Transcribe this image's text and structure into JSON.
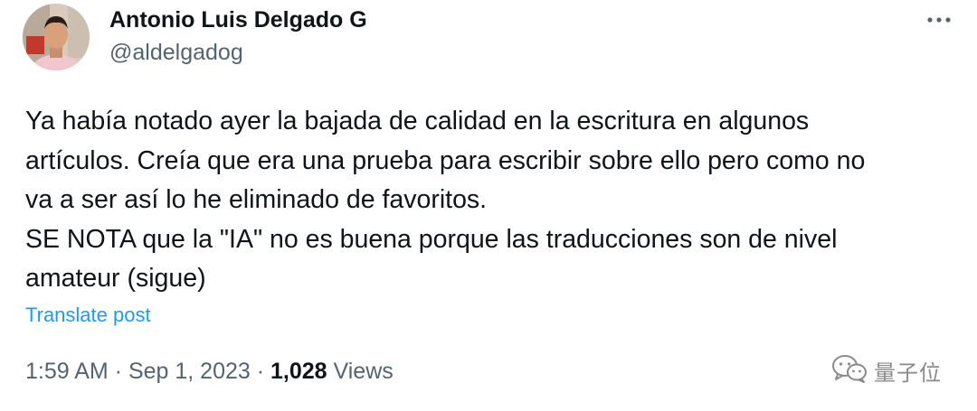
{
  "author": {
    "name": "Antonio Luis Delgado G",
    "handle": "@aldelgadog"
  },
  "tweet": {
    "lines": [
      "Ya había notado ayer la bajada de calidad en la escritura en algunos",
      "artículos. Creía que era una prueba para escribir sobre ello pero como no",
      "va a ser así lo he eliminado de favoritos.",
      "SE NOTA que la \"IA\" no es buena porque las traducciones son de nivel",
      "amateur (sigue)"
    ],
    "translate_label": "Translate post"
  },
  "meta": {
    "time": "1:59 AM",
    "separator": " · ",
    "date": "Sep 1, 2023",
    "views_count": "1,028",
    "views_label": "Views"
  },
  "watermark": {
    "text": "量子位"
  },
  "icons": {
    "more": "more-horizontal-icon",
    "watermark": "wechat-icon"
  },
  "colors": {
    "text_primary": "#0f1419",
    "text_secondary": "#536471",
    "link": "#1d9bf0",
    "watermark": "#8a8a8a"
  }
}
